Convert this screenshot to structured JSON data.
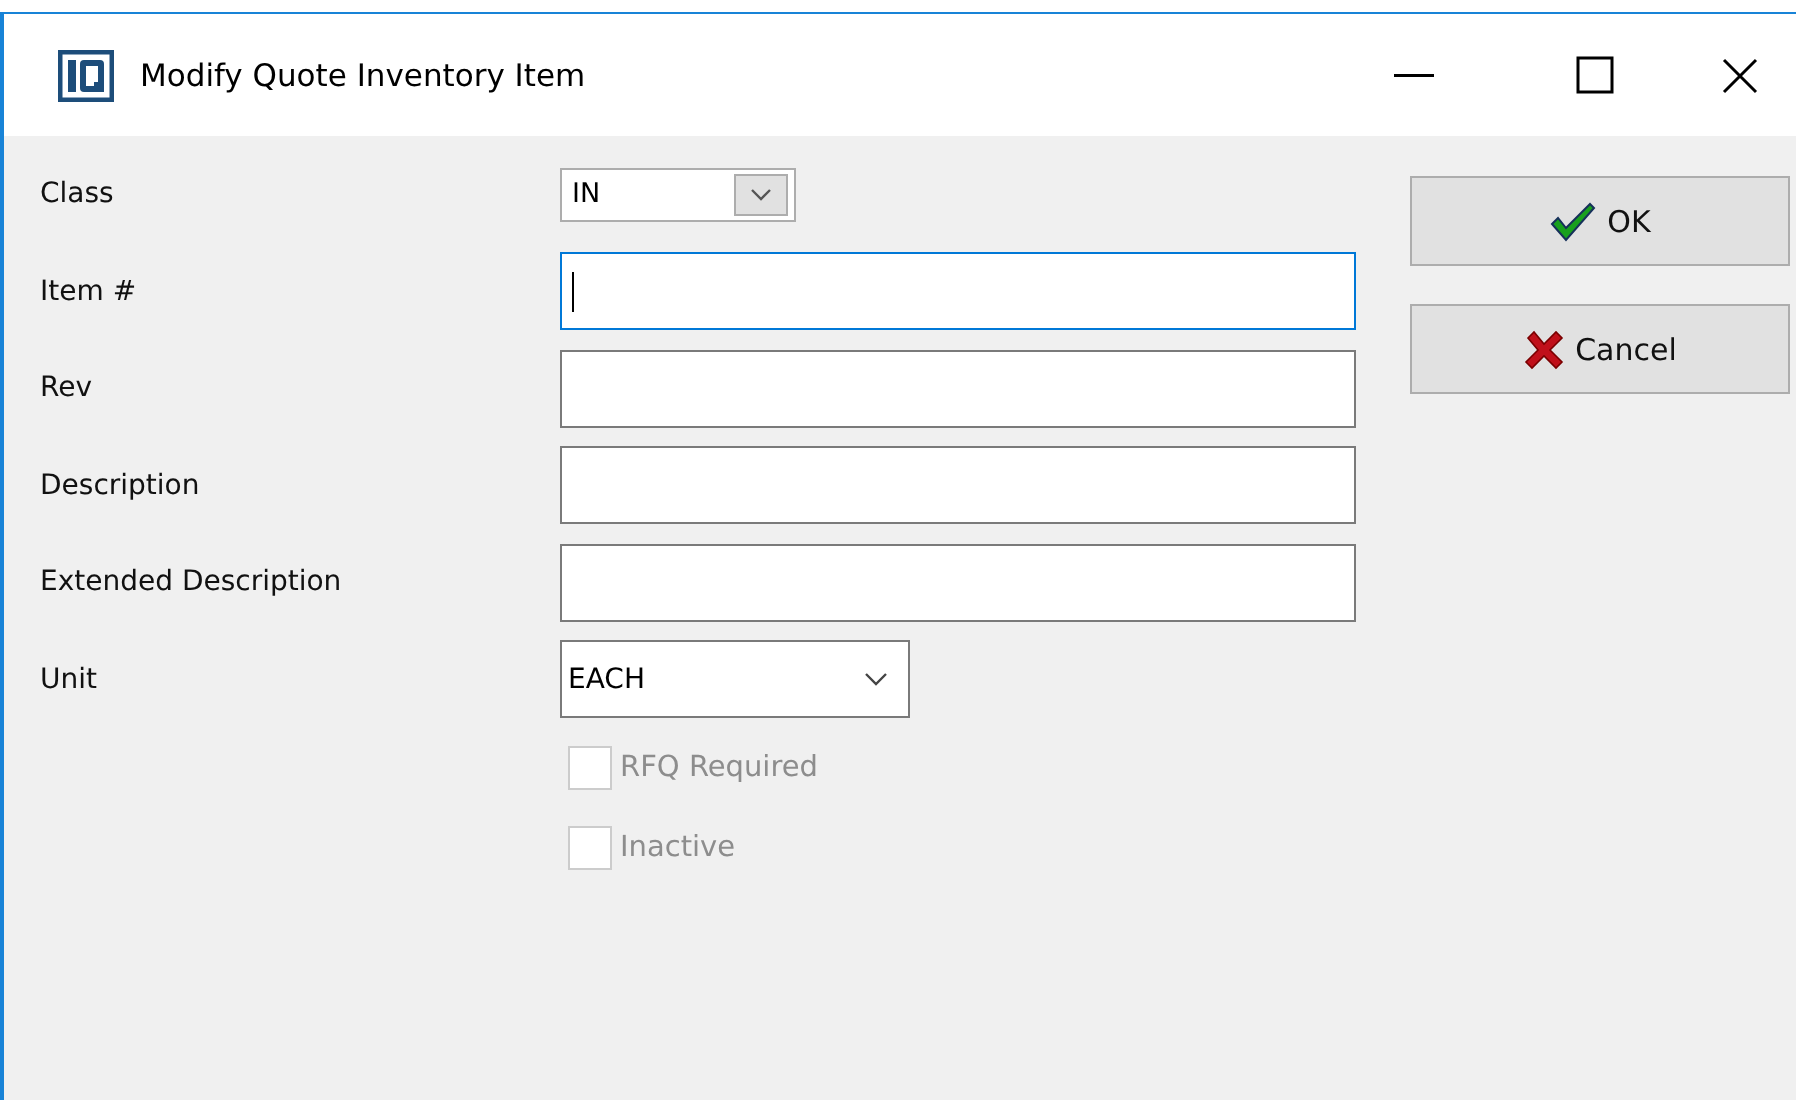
{
  "window": {
    "title": "Modify Quote Inventory Item"
  },
  "fields": [
    {
      "kind": "combo",
      "label": "Class",
      "value": "IN",
      "focused": false
    },
    {
      "kind": "text",
      "label": "Item #",
      "focused": true
    },
    {
      "kind": "text",
      "label": "Rev",
      "focused": false
    },
    {
      "kind": "text",
      "label": "Description",
      "focused": false
    },
    {
      "kind": "text",
      "label": "Extended Description",
      "focused": false
    },
    {
      "kind": "dropdown",
      "label": "Unit",
      "value": "EACH",
      "focused": false
    }
  ],
  "checkboxes": [
    {
      "label": "RFQ Required",
      "checked": false,
      "disabled": true
    },
    {
      "label": "Inactive",
      "checked": false,
      "disabled": true
    }
  ],
  "buttons": [
    {
      "kind": "ok",
      "label": "OK"
    },
    {
      "kind": "cancel",
      "label": "Cancel"
    }
  ]
}
